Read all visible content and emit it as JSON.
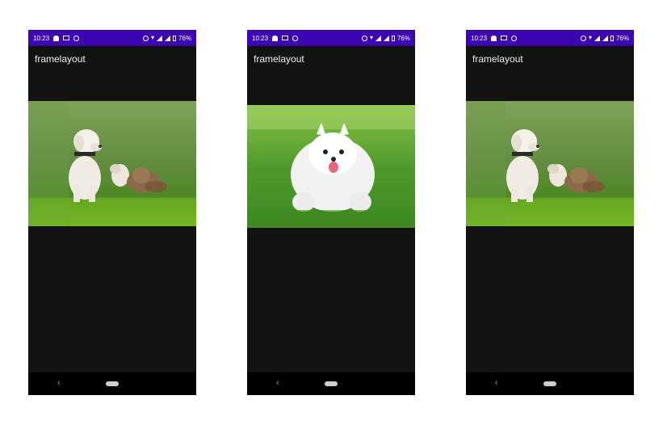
{
  "screens": [
    {
      "status": {
        "time": "10:23",
        "battery": "76%"
      },
      "app_title": "framelayout",
      "image": "puppy-and-kitten-photo"
    },
    {
      "status": {
        "time": "10:23",
        "battery": "76%"
      },
      "app_title": "framelayout",
      "image": "white-pomeranian-photo"
    },
    {
      "status": {
        "time": "10:23",
        "battery": "76%"
      },
      "app_title": "framelayout",
      "image": "puppy-and-kitten-photo"
    }
  ],
  "nav": {
    "back_symbol": "‹"
  },
  "colors": {
    "status_bar": "#3b05b0",
    "app_background": "#121212",
    "nav_bar": "#000000"
  }
}
